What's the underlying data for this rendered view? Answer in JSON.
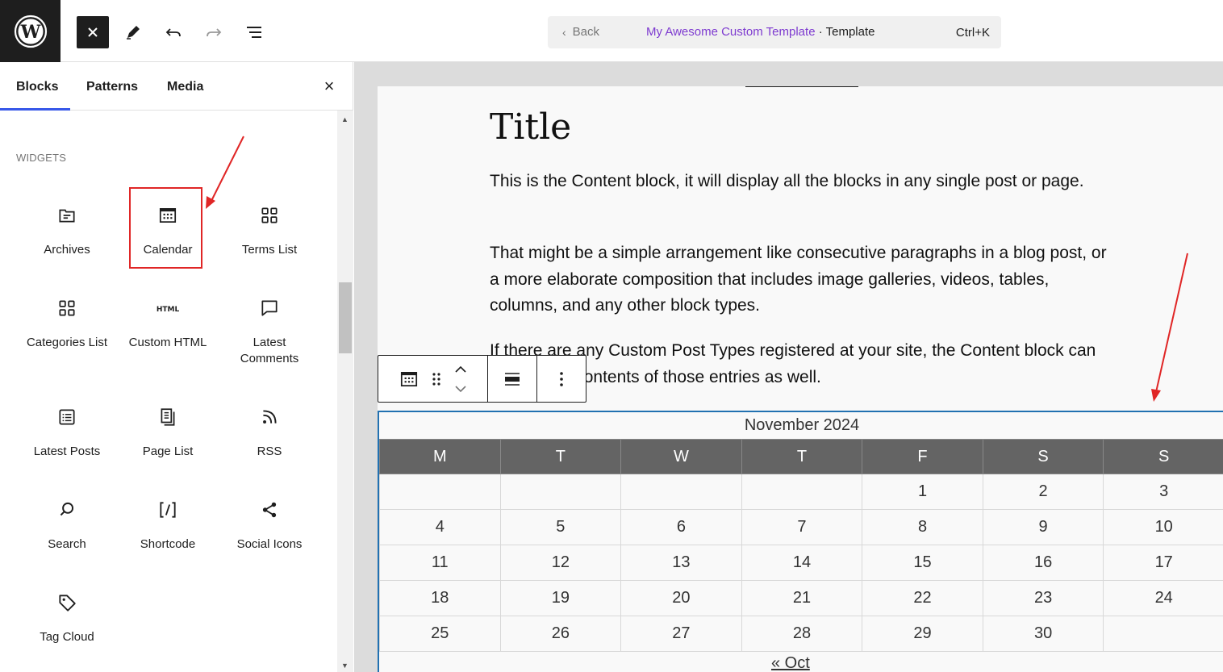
{
  "topbar": {
    "back_label": "Back",
    "template_name": "My Awesome Custom Template",
    "separator": "·",
    "template_type": "Template",
    "shortcut": "Ctrl+K"
  },
  "sidebar": {
    "tabs": [
      "Blocks",
      "Patterns",
      "Media"
    ],
    "close": "×",
    "section_title": "WIDGETS",
    "blocks": [
      {
        "label": "Archives",
        "icon": "archives-icon"
      },
      {
        "label": "Calendar",
        "icon": "calendar-icon"
      },
      {
        "label": "Terms List",
        "icon": "terms-list-icon"
      },
      {
        "label": "Categories List",
        "icon": "categories-list-icon"
      },
      {
        "label": "Custom HTML",
        "icon": "custom-html-icon"
      },
      {
        "label": "Latest Comments",
        "icon": "latest-comments-icon"
      },
      {
        "label": "Latest Posts",
        "icon": "latest-posts-icon"
      },
      {
        "label": "Page List",
        "icon": "page-list-icon"
      },
      {
        "label": "RSS",
        "icon": "rss-icon"
      },
      {
        "label": "Search",
        "icon": "search-icon"
      },
      {
        "label": "Shortcode",
        "icon": "shortcode-icon"
      },
      {
        "label": "Social Icons",
        "icon": "share-icon"
      },
      {
        "label": "Tag Cloud",
        "icon": "tag-icon"
      }
    ]
  },
  "content": {
    "title": "Title",
    "paragraphs": [
      "This is the Content block, it will display all the blocks in any single post or page.",
      "That might be a simple arrangement like consecutive paragraphs in a blog post, or a more elaborate composition that includes image galleries, videos, tables, columns, and any other block types.",
      "If there are any Custom Post Types registered at your site, the Content block can display the contents of those entries as well."
    ]
  },
  "calendar": {
    "caption": "November 2024",
    "headers": [
      "M",
      "T",
      "W",
      "T",
      "F",
      "S",
      "S"
    ],
    "rows": [
      [
        "",
        "",
        "",
        "",
        "1",
        "2",
        "3"
      ],
      [
        "4",
        "5",
        "6",
        "7",
        "8",
        "9",
        "10"
      ],
      [
        "11",
        "12",
        "13",
        "14",
        "15",
        "16",
        "17"
      ],
      [
        "18",
        "19",
        "20",
        "21",
        "22",
        "23",
        "24"
      ],
      [
        "25",
        "26",
        "27",
        "28",
        "29",
        "30",
        ""
      ]
    ],
    "prev_link": "« Oct"
  },
  "colors": {
    "accent": "#3858e9",
    "highlight": "#e02626",
    "template_name": "#7e3bd0",
    "calendar_header": "#646464"
  }
}
